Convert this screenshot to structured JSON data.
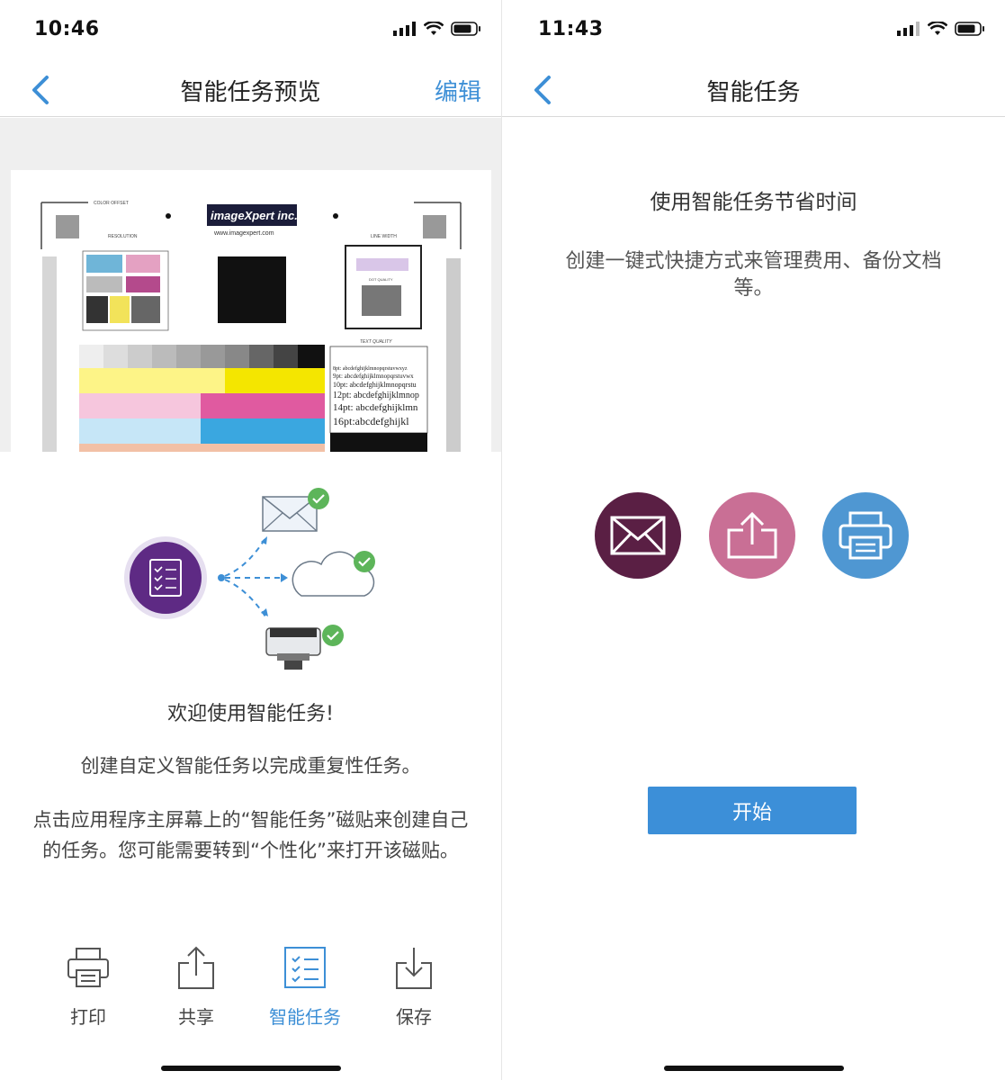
{
  "left": {
    "status_time": "10:46",
    "nav_title": "智能任务预览",
    "nav_edit": "编辑",
    "welcome_title": "欢迎使用智能任务!",
    "desc1": "创建自定义智能任务以完成重复性任务。",
    "desc2": "点击应用程序主屏幕上的“智能任务”磁贴来创建自己的任务。您可能需要转到“个性化”来打开该磁贴。",
    "preview": {
      "logo_text": "imageXpert inc.",
      "logo_url": "www.imagexpert.com",
      "labels": {
        "color_offset": "COLOR OFFSET",
        "resolution": "RESOLUTION",
        "line_width": "LINE WIDTH",
        "dot_quality": "DOT QUALITY",
        "text_quality": "TEXT QUALITY"
      },
      "text_samples": [
        "8pt: abcdefghijklmnopqrstuvwxyz",
        "9pt: abcdefghijklmnopqrstuvwx",
        "10pt: abcdefghijklmnopqrstu",
        "12pt: abcdefghijklmnop",
        "14pt: abcdefghijklmn",
        "16pt:abcdefghijkl"
      ]
    },
    "toolbar": [
      {
        "label": "打印",
        "icon": "printer-icon"
      },
      {
        "label": "共享",
        "icon": "share-icon"
      },
      {
        "label": "智能任务",
        "icon": "smart-task-icon",
        "active": true
      },
      {
        "label": "保存",
        "icon": "download-icon"
      }
    ]
  },
  "right": {
    "status_time": "11:43",
    "nav_title": "智能任务",
    "heading": "使用智能任务节省时间",
    "desc": "创建一键式快捷方式来管理费用、备份文档等。",
    "circle_colors": {
      "email": "#5a1f44",
      "share": "#c96f95",
      "print": "#4f97d2"
    },
    "start_button": "开始"
  },
  "colors": {
    "accent": "#3d8fd6",
    "smart_task_purple": "#5e2a84",
    "check_green": "#5db55a"
  }
}
